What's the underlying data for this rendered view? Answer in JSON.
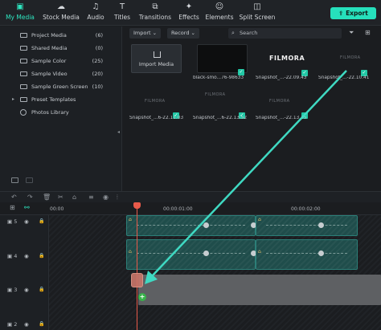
{
  "tabs": [
    {
      "label": "My Media",
      "icon": "folder-icon",
      "active": true
    },
    {
      "label": "Stock Media",
      "icon": "cloud-icon",
      "active": false
    },
    {
      "label": "Audio",
      "icon": "music-icon",
      "active": false
    },
    {
      "label": "Titles",
      "icon": "text-icon",
      "active": false
    },
    {
      "label": "Transitions",
      "icon": "transition-icon",
      "active": false
    },
    {
      "label": "Effects",
      "icon": "sparkle-icon",
      "active": false
    },
    {
      "label": "Elements",
      "icon": "elements-icon",
      "active": false
    },
    {
      "label": "Split Screen",
      "icon": "split-screen-icon",
      "active": false
    }
  ],
  "export_label": "Export",
  "folders": [
    {
      "name": "Project Media",
      "count": "(6)"
    },
    {
      "name": "Shared Media",
      "count": "(0)"
    },
    {
      "name": "Sample Color",
      "count": "(25)"
    },
    {
      "name": "Sample Video",
      "count": "(20)"
    },
    {
      "name": "Sample Green Screen",
      "count": "(10)"
    },
    {
      "name": "Preset Templates",
      "count": ""
    },
    {
      "name": "Photos Library",
      "count": ""
    }
  ],
  "media_toolbar": {
    "import_label": "Import",
    "record_label": "Record",
    "search_placeholder": "Search"
  },
  "media_items": [
    {
      "label": "Import Media"
    },
    {
      "label": "black-smo...76-98633"
    },
    {
      "label": "Snapshot_...-22.09.43",
      "thumb_text": "FILMORA"
    },
    {
      "label": "Snapshot_...-22.10.41",
      "thumb_text": "FILMORA"
    },
    {
      "label": "Snapshot_...6-22.11.03",
      "thumb_text": "FILMORA"
    },
    {
      "label": "Snapshot_...6-22.13.52",
      "thumb_text": "FILMORA"
    },
    {
      "label": "Snapshot_...-22.13.45",
      "thumb_text": "FILMORA"
    }
  ],
  "timeline": {
    "timecodes": [
      "00:00",
      "00:00:01:00",
      "00:00:02:00"
    ],
    "tracks": [
      {
        "number": "5"
      },
      {
        "number": "4"
      },
      {
        "number": "3"
      },
      {
        "number": "2"
      }
    ]
  },
  "colors": {
    "accent": "#26e0bc",
    "playhead": "#e85a4a",
    "clip_teal": "#1f4d4b",
    "arrow": "#3fd9c2"
  }
}
